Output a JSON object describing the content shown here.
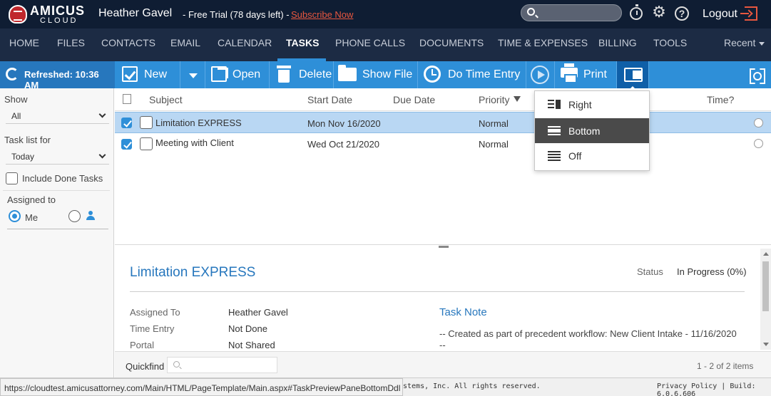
{
  "header": {
    "logo_text": "AMICUS",
    "logo_sub": "CLOUD",
    "user_name": "Heather Gavel",
    "trial_text": "- Free Trial (78 days left)  -",
    "subscribe_label": "Subscribe Now",
    "logout_label": "Logout"
  },
  "nav": {
    "items": [
      "HOME",
      "FILES",
      "CONTACTS",
      "EMAIL",
      "CALENDAR",
      "TASKS",
      "PHONE CALLS",
      "DOCUMENTS",
      "TIME & EXPENSES",
      "BILLING",
      "TOOLS"
    ],
    "active": "TASKS",
    "recent_label": "Recent"
  },
  "toolbar": {
    "refreshed_label": "Refreshed: 10:36 AM",
    "new_label": "New",
    "open_label": "Open",
    "delete_label": "Delete",
    "show_file_label": "Show File",
    "do_time_entry_label": "Do Time Entry",
    "print_label": "Print"
  },
  "sidebar": {
    "show_label": "Show",
    "show_value": "All",
    "task_list_label": "Task list for",
    "task_list_value": "Today",
    "include_done_label": "Include Done Tasks",
    "assigned_to_label": "Assigned to",
    "me_label": "Me"
  },
  "grid": {
    "columns": [
      "Subject",
      "Start Date",
      "Due Date",
      "Priority",
      "Time?"
    ],
    "rows": [
      {
        "subject": "Limitation EXPRESS",
        "start_date": "Mon Nov 16/2020",
        "due_date": "",
        "priority": "Normal"
      },
      {
        "subject": "Meeting with Client",
        "start_date": "Wed Oct 21/2020",
        "due_date": "",
        "priority": "Normal"
      }
    ]
  },
  "preview_pane_menu": {
    "items": [
      "Right",
      "Bottom",
      "Off"
    ],
    "selected": "Bottom"
  },
  "detail": {
    "title": "Limitation EXPRESS",
    "status_label": "Status",
    "status_value": "In Progress (0%)",
    "assigned_to_label": "Assigned To",
    "assigned_to_value": "Heather Gavel",
    "time_entry_label": "Time Entry",
    "time_entry_value": "Not Done",
    "portal_label": "Portal",
    "portal_value": "Not Shared",
    "note_title": "Task Note",
    "note_text": "-- Created as part of precedent workflow: New Client Intake - 11/16/2020",
    "note_text2": "--"
  },
  "quickfind": {
    "label": "Quickfind",
    "count_text": "1 - 2 of 2 items"
  },
  "footer": {
    "url": "https://cloudtest.amicusattorney.com/Main/HTML/PageTemplate/Main.aspx#TaskPreviewPaneBottomDdl",
    "copyright": "stems, Inc. All rights reserved.",
    "privacy": "Privacy Policy | Build: 6.0.6.606"
  },
  "colors": {
    "header_bg": "#0f1d33",
    "nav_bg": "#1c2b44",
    "toolbar_bg": "#2e8fd8",
    "accent": "#2777bd",
    "subscribe": "#e8573f",
    "selected_row": "#b9d7f3"
  }
}
